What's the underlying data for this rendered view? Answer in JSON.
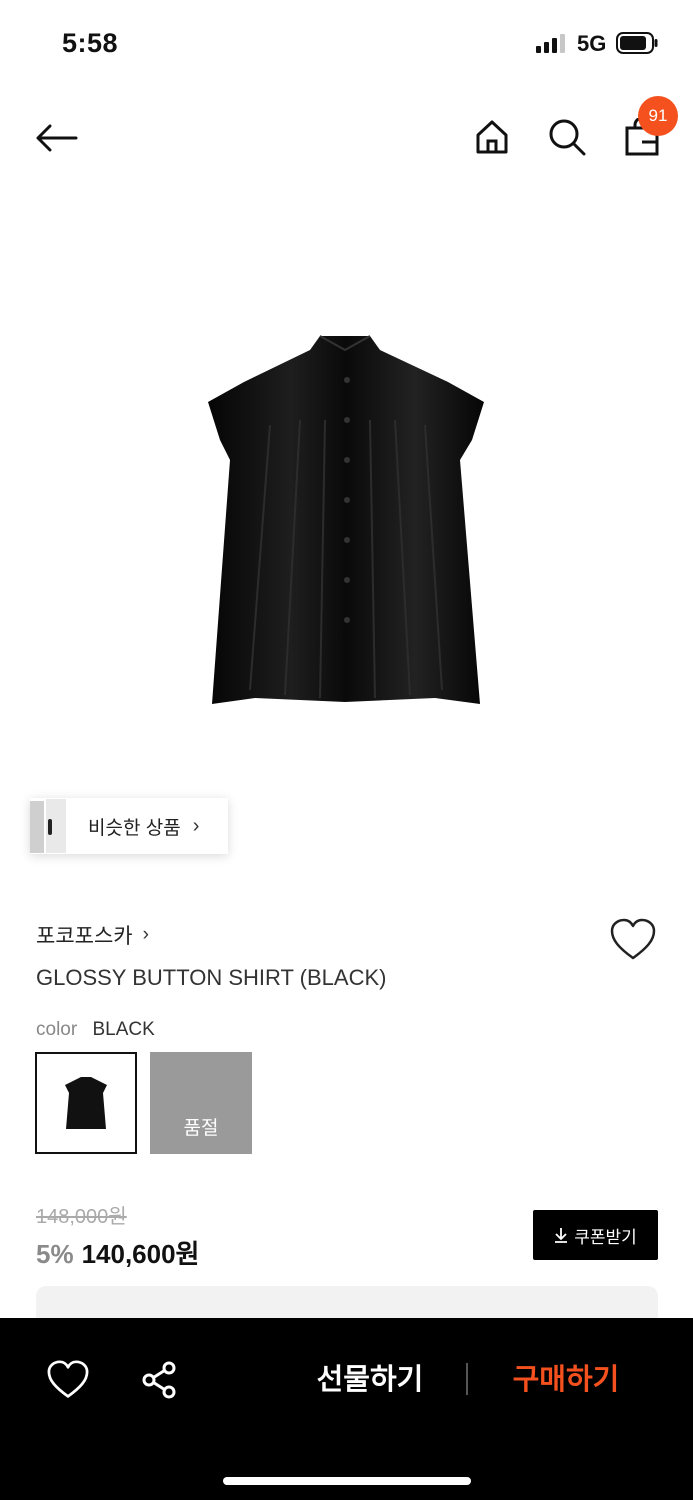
{
  "status_bar": {
    "time": "5:58",
    "network": "5G"
  },
  "header": {
    "cart_count": "91"
  },
  "similar": {
    "label": "비슷한 상품",
    "chevron": "›"
  },
  "product": {
    "brand": "포코포스카",
    "brand_chevron": "›",
    "name": "GLOSSY BUTTON SHIRT (BLACK)",
    "color_key": "color",
    "color_value": "BLACK",
    "options": [
      {
        "color": "BLACK",
        "status": "available"
      },
      {
        "status_label": "품절"
      }
    ]
  },
  "price": {
    "original": "148,000원",
    "discount": "5%",
    "sale": "140,600원",
    "coupon_label": "쿠폰받기"
  },
  "bottom_bar": {
    "gift_label": "선물하기",
    "buy_label": "구매하기"
  },
  "colors": {
    "accent": "#f4511e",
    "sold_out_gray": "#9a9a9a"
  },
  "icons": [
    "back-arrow-icon",
    "home-icon",
    "search-icon",
    "shopping-bag-icon",
    "heart-icon",
    "share-icon",
    "download-icon",
    "chevron-right-icon"
  ]
}
